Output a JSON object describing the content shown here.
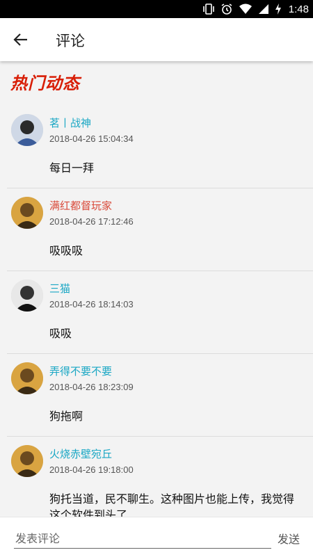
{
  "status_bar": {
    "time": "1:48",
    "icons": [
      "vibrate-icon",
      "alarm-icon",
      "wifi-icon",
      "signal-icon",
      "battery-charging-icon"
    ]
  },
  "header": {
    "back_icon": "arrow-left-icon",
    "title": "评论"
  },
  "section_title": "热门动态",
  "colors": {
    "accent_cyan": "#1aa7c4",
    "accent_red": "#d94a3a",
    "section_red": "#d81e06"
  },
  "comments": [
    {
      "username": "茗丨战神",
      "name_color": "#1aa7c4",
      "time": "2018-04-26 15:04:34",
      "text": "每日一拜",
      "avatar": "avatar-icon"
    },
    {
      "username": "满红都督玩家",
      "name_color": "#d94a3a",
      "time": "2018-04-26 17:12:46",
      "text": "吸吸吸",
      "avatar": "avatar-icon"
    },
    {
      "username": "三猫",
      "name_color": "#1aa7c4",
      "time": "2018-04-26 18:14:03",
      "text": "吸吸",
      "avatar": "avatar-icon"
    },
    {
      "username": "弄得不要不要",
      "name_color": "#1aa7c4",
      "time": "2018-04-26 18:23:09",
      "text": "狗拖啊",
      "avatar": "avatar-icon"
    },
    {
      "username": "火烧赤壁宛丘",
      "name_color": "#1aa7c4",
      "time": "2018-04-26 19:18:00",
      "text": "狗托当道，民不聊生。这种图片也能上传，我觉得这个软件到头了",
      "avatar": "avatar-icon"
    }
  ],
  "input": {
    "placeholder": "发表评论",
    "value": ""
  },
  "send_label": "发送"
}
